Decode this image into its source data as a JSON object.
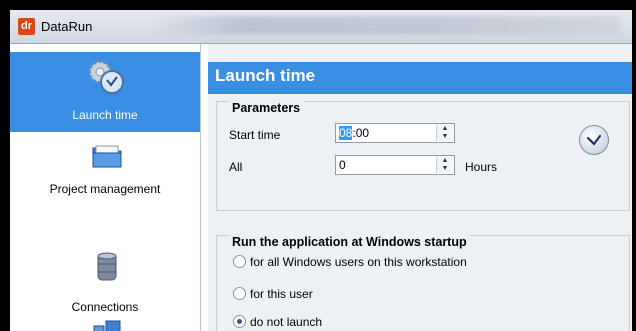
{
  "window": {
    "app_logo": "dr",
    "title": "DataRun"
  },
  "sidebar": {
    "items": [
      {
        "label": "Launch time",
        "icon": "gears-clock-icon",
        "active": true
      },
      {
        "label": "Project management",
        "icon": "folder-icon",
        "active": false
      },
      {
        "label": "Connections",
        "icon": "database-icon",
        "active": false
      },
      {
        "label": "",
        "icon": "network-icon",
        "active": false
      }
    ]
  },
  "main": {
    "header_title": "Launch time",
    "parameters": {
      "title": "Parameters",
      "start_time_label": "Start time",
      "start_time_hours": "08",
      "start_time_rest": ":00",
      "all_label": "All",
      "all_value": "0",
      "hours_label": "Hours",
      "clock_icon": "clock-icon"
    },
    "startup": {
      "title": "Run the application at Windows startup",
      "options": [
        {
          "label": "for all Windows users on this workstation",
          "checked": false
        },
        {
          "label": "for this user",
          "checked": false
        },
        {
          "label": "do not launch",
          "checked": true
        }
      ]
    }
  },
  "colors": {
    "accent": "#3a8ee3",
    "selection": "#3399ff"
  }
}
